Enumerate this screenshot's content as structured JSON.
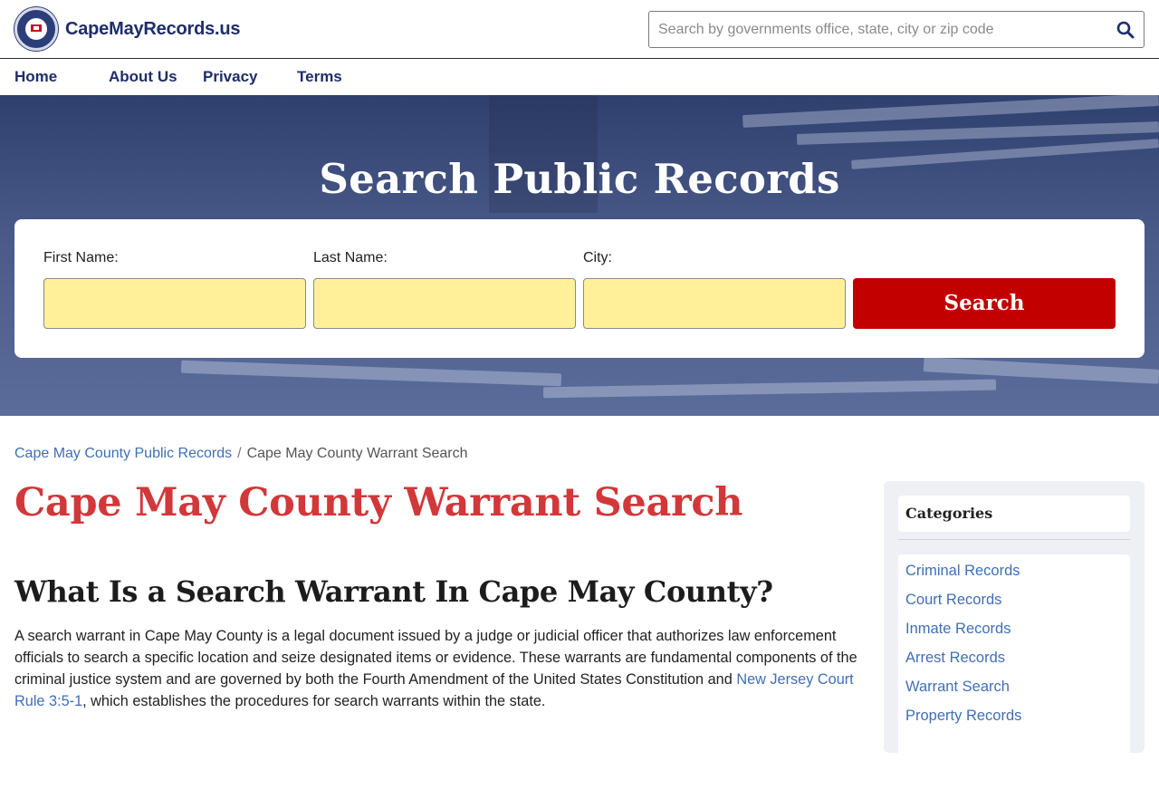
{
  "site": {
    "name": "CapeMayRecords.us",
    "search_placeholder": "Search by governments office, state, city or zip code"
  },
  "nav": {
    "home": "Home",
    "about": "About Us",
    "privacy": "Privacy",
    "terms": "Terms"
  },
  "hero": {
    "title": "Search Public Records",
    "first_name_label": "First Name:",
    "last_name_label": "Last Name:",
    "city_label": "City:",
    "search_button": "Search"
  },
  "breadcrumb": {
    "parent": "Cape May County Public Records",
    "separator": "/",
    "current": "Cape May County Warrant Search"
  },
  "main": {
    "title": "Cape May County Warrant Search",
    "section_title": "What Is a Search Warrant In Cape May County?",
    "paragraph_before_link": "A search warrant in Cape May County is a legal document issued by a judge or judicial officer that authorizes law enforcement officials to search a specific location and seize designated items or evidence. These warrants are fundamental components of the criminal justice system and are governed by both the Fourth Amendment of the United States Constitution and ",
    "paragraph_link": "New Jersey Court Rule 3:5-1",
    "paragraph_after_link": ", which establishes the procedures for search warrants within the state."
  },
  "sidebar": {
    "heading": "Categories",
    "items": [
      {
        "label": "Criminal Records"
      },
      {
        "label": "Court Records"
      },
      {
        "label": "Inmate Records"
      },
      {
        "label": "Arrest Records"
      },
      {
        "label": "Warrant Search"
      },
      {
        "label": "Property Records"
      }
    ]
  },
  "colors": {
    "brand_navy": "#1e2d6b",
    "title_red": "#d2373a",
    "button_red": "#c20000",
    "link_blue": "#3f6fb6",
    "field_yellow": "#fff099"
  },
  "icons": {
    "search": "search-icon",
    "logo": "seal-logo-icon"
  }
}
